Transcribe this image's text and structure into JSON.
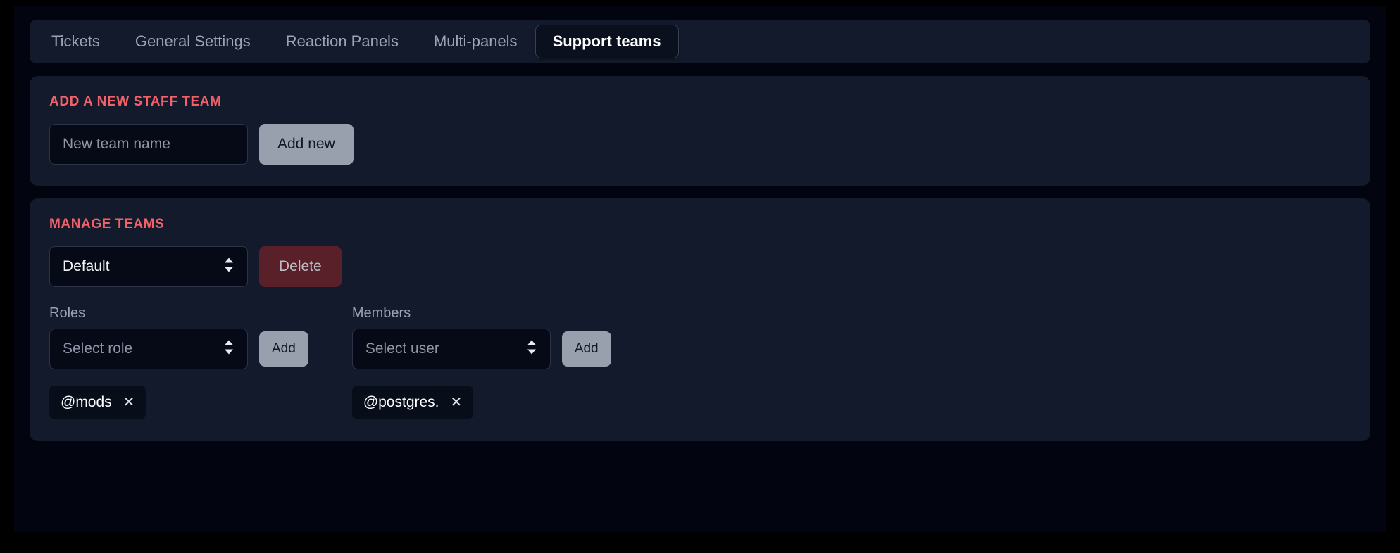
{
  "tabs": [
    {
      "label": "Tickets",
      "active": false
    },
    {
      "label": "General Settings",
      "active": false
    },
    {
      "label": "Reaction Panels",
      "active": false
    },
    {
      "label": "Multi-panels",
      "active": false
    },
    {
      "label": "Support teams",
      "active": true
    }
  ],
  "add_team_panel": {
    "title": "ADD A NEW STAFF TEAM",
    "team_name_placeholder": "New team name",
    "team_name_value": "",
    "add_button_label": "Add new"
  },
  "manage_teams_panel": {
    "title": "MANAGE TEAMS",
    "team_select_value": "Default",
    "delete_button_label": "Delete",
    "roles": {
      "label": "Roles",
      "select_placeholder": "Select role",
      "add_button_label": "Add",
      "chips": [
        {
          "label": "@mods",
          "remove_icon": "close-icon"
        }
      ]
    },
    "members": {
      "label": "Members",
      "select_placeholder": "Select user",
      "add_button_label": "Add",
      "chips": [
        {
          "label": "@postgres.",
          "remove_icon": "close-icon"
        }
      ]
    }
  },
  "colors": {
    "page_background": "#02050f",
    "panel_background": "#131a2b",
    "section_title": "#f2616a",
    "input_background": "#050a16",
    "button_gray": "#99a0ad",
    "button_danger": "#59202a",
    "tab_inactive_text": "#9aa4b8",
    "tab_active_background": "#0b101e"
  }
}
